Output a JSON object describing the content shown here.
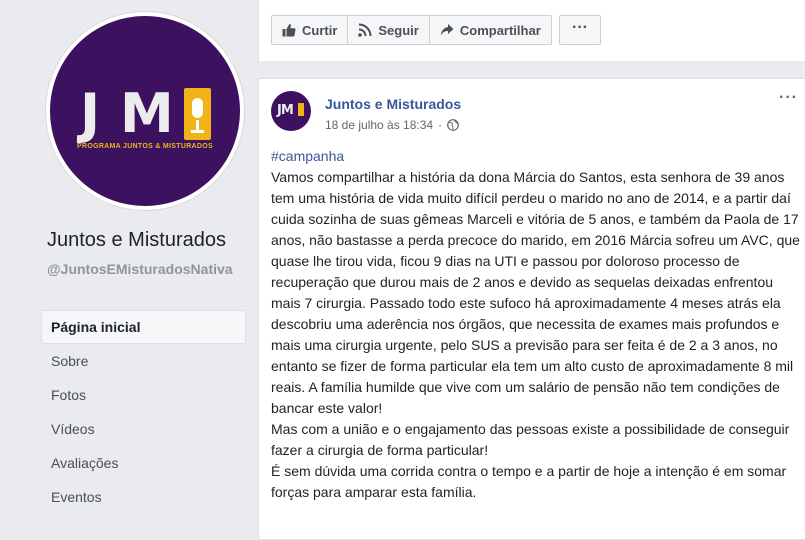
{
  "page": {
    "name": "Juntos e Misturados",
    "handle": "@JuntosEMisturadosNativa",
    "logo": {
      "letters_left": "J",
      "letters_right": "M",
      "subtitle": "PROGRAMA JUNTOS & MISTURADOS"
    }
  },
  "nav": {
    "items": [
      {
        "label": "Página inicial",
        "active": true
      },
      {
        "label": "Sobre"
      },
      {
        "label": "Fotos"
      },
      {
        "label": "Vídeos"
      },
      {
        "label": "Avaliações"
      },
      {
        "label": "Eventos"
      }
    ]
  },
  "actions": {
    "like_label": "Curtir",
    "like_icon": "thumbs-up-icon",
    "follow_label": "Seguir",
    "follow_icon": "rss-icon",
    "share_label": "Compartilhar",
    "share_icon": "share-arrow-icon",
    "more_label": "···"
  },
  "post": {
    "author": "Juntos e Misturados",
    "date": "18 de julho às 18:34",
    "separator": "·",
    "privacy_icon": "globe-icon",
    "options_label": "···",
    "hashtag": "#campanha",
    "paragraphs": [
      "Vamos compartilhar a história da dona Márcia do Santos, esta senhora de 39 anos tem uma história de vida muito difícil perdeu o marido no ano de 2014, e a partir daí cuida sozinha de suas gêmeas Marceli e vitória de 5 anos, e também da Paola de 17 anos, não bastasse a perda precoce do marido, em 2016 Márcia sofreu um AVC, que quase lhe tirou vida, ficou 9 dias na UTI e passou por doloroso processo de recuperação que durou mais de 2 anos e devido as sequelas deixadas enfrentou mais 7 cirurgia. Passado todo este sufoco há aproximadamente 4 meses atrás ela descobriu uma aderência nos órgãos, que necessita de exames mais profundos e mais uma cirurgia urgente, pelo SUS a previsão para ser feita é de 2 a 3 anos, no entanto se fizer de forma particular ela tem um alto custo de aproximadamente 8 mil reais. A família humilde que vive com um salário de pensão não tem condições de bancar este valor!",
      "Mas com a união e o engajamento das pessoas existe a possibilidade de conseguir fazer a cirurgia de forma particular!",
      "É sem dúvida uma corrida contra o tempo e a partir de hoje a intenção é em somar forças para amparar esta família."
    ]
  },
  "colors": {
    "logo_bg": "#3c1260",
    "logo_accent": "#f0b418",
    "link": "#365899",
    "page_bg": "#e9ebee"
  }
}
